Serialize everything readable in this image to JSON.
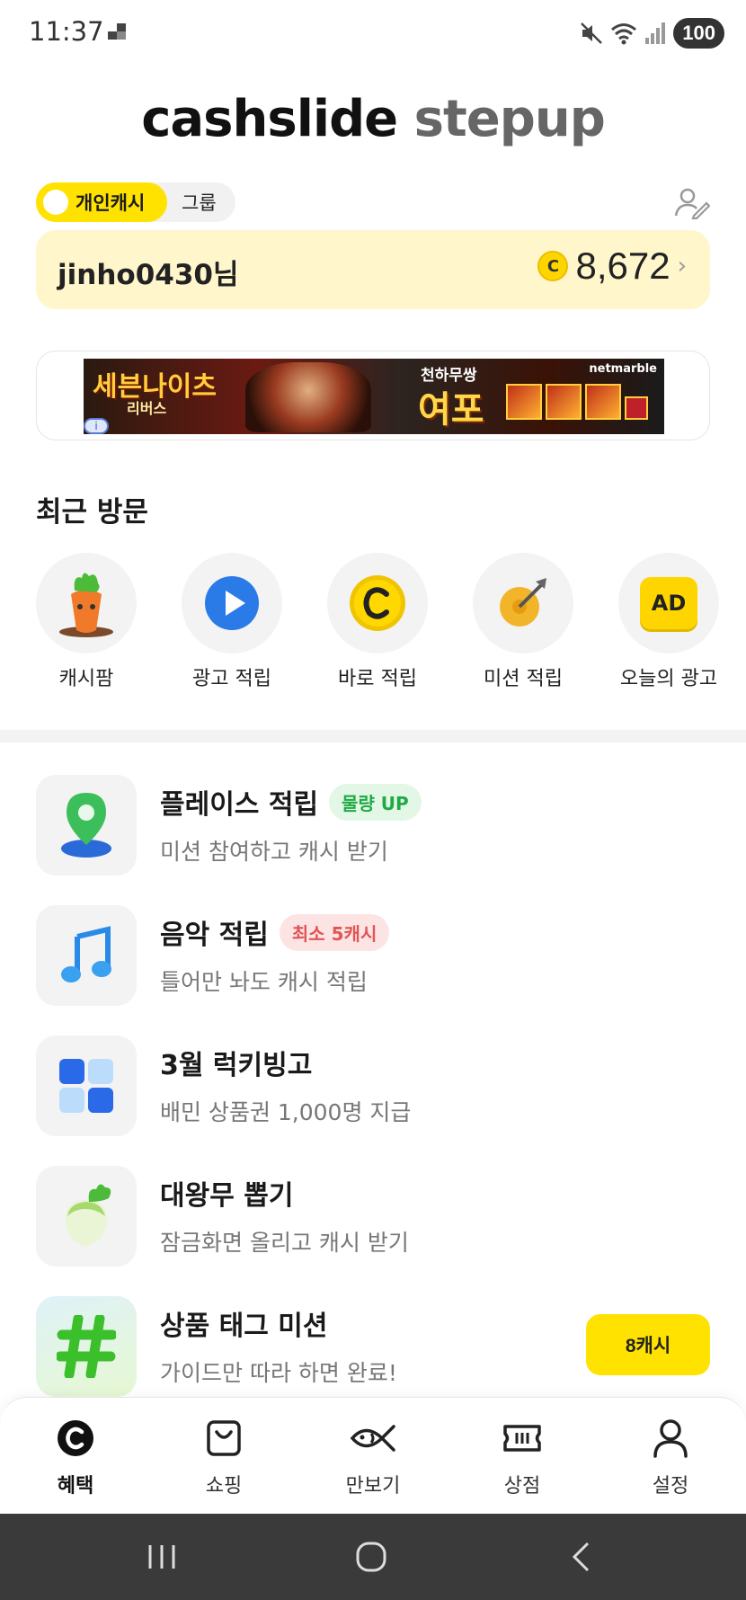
{
  "status_bar": {
    "time": "11:37",
    "battery": "100",
    "icons": [
      "mute-icon",
      "wifi-icon",
      "signal-icon"
    ]
  },
  "logo": {
    "part1": "cashslide",
    "part2": "stepup"
  },
  "toggle": {
    "personal_label": "개인캐시",
    "group_label": "그룹"
  },
  "user": {
    "name": "jinho0430님",
    "balance": "8,672",
    "coin_symbol": "C"
  },
  "ad": {
    "left_title": "세븐나이츠",
    "left_sub": "리버스",
    "tagline": "천하무쌍",
    "title": "여포",
    "brand": "netmarble",
    "info_symbol": "i"
  },
  "recent": {
    "title": "최근 방문",
    "items": [
      {
        "label": "캐시팜",
        "icon": "carrot-icon"
      },
      {
        "label": "광고 적립",
        "icon": "play-icon"
      },
      {
        "label": "바로 적립",
        "icon": "coin-c-icon"
      },
      {
        "label": "미션 적립",
        "icon": "target-icon"
      },
      {
        "label": "오늘의 광고",
        "icon": "ad-badge-icon",
        "icon_text": "AD"
      }
    ]
  },
  "list": [
    {
      "title": "플레이스 적립",
      "badge": "물량 UP",
      "badge_color": "#1faa45",
      "subtitle": "미션 참여하고 캐시 받기",
      "icon": "map-pin-icon"
    },
    {
      "title": "음악 적립",
      "badge": "최소 5캐시",
      "badge_color": "#e05555",
      "subtitle": "틀어만 놔도 캐시 적립",
      "icon": "music-note-icon"
    },
    {
      "title": "3월 럭키빙고",
      "subtitle": "배민 상품권 1,000명 지급",
      "icon": "bingo-grid-icon"
    },
    {
      "title": "대왕무 뽑기",
      "subtitle": "잠금화면 올리고 캐시 받기",
      "icon": "radish-icon"
    },
    {
      "title": "상품 태그 미션",
      "subtitle": "가이드만 따라 하면 완료!",
      "icon": "hashtag-icon",
      "button": "8캐시"
    }
  ],
  "bottom_nav": [
    {
      "label": "혜택",
      "icon": "benefit-c-icon",
      "active": true
    },
    {
      "label": "쇼핑",
      "icon": "shopping-bag-icon"
    },
    {
      "label": "만보기",
      "icon": "fish-icon"
    },
    {
      "label": "상점",
      "icon": "ticket-icon"
    },
    {
      "label": "설정",
      "icon": "person-icon"
    }
  ],
  "colors": {
    "accent": "#ffe200",
    "card_bg": "#fff6cc",
    "system_nav": "#3a3a3a"
  }
}
